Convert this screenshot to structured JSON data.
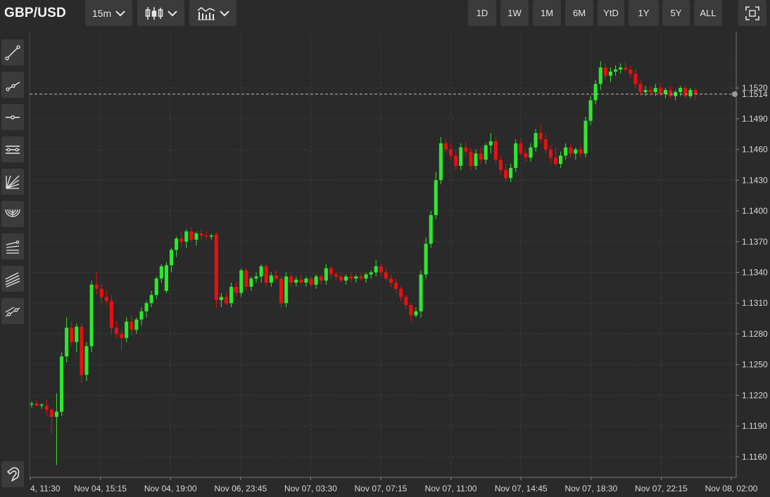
{
  "toolbar": {
    "symbol": "GBP/USD",
    "interval": "15m",
    "chart_type_icon": "candlestick-icon",
    "indicators_icon": "indicators-icon",
    "ranges": [
      "1D",
      "1W",
      "1M",
      "6M",
      "YtD",
      "1Y",
      "5Y",
      "ALL"
    ],
    "fullscreen_icon": "fullscreen-icon"
  },
  "tools": [
    "trend-line-icon",
    "ray-icon",
    "horizontal-line-icon",
    "parallel-channel-icon",
    "fib-fan-icon",
    "fib-arcs-icon",
    "fib-retracement-icon",
    "fib-channel-icon",
    "extended-line-icon",
    "magnet-icon"
  ],
  "colors": {
    "up": "#2ee82e",
    "down": "#e81010",
    "background": "#2a2a2a",
    "grid": "#3c3c3c"
  },
  "chart_data": {
    "type": "candlestick",
    "ylim": [
      1.114,
      1.1575
    ],
    "y_ticks": [
      "1.1520",
      "1.1490",
      "1.1460",
      "1.1430",
      "1.1400",
      "1.1370",
      "1.1340",
      "1.1310",
      "1.1280",
      "1.1250",
      "1.1220",
      "1.1190",
      "1.1160"
    ],
    "x_ticks": [
      "4, 11:30",
      "Nov 04, 15:15",
      "Nov 04, 19:00",
      "Nov 06, 23:45",
      "Nov 07, 03:30",
      "Nov 07, 07:15",
      "Nov 07, 11:00",
      "Nov 07, 14:45",
      "Nov 07, 18:30",
      "Nov 07, 22:15",
      "Nov 08, 02:00"
    ],
    "last_price": "1.1514",
    "grid": true,
    "candles": [
      [
        1.1211,
        1.1214,
        1.1208,
        1.1212
      ],
      [
        1.1212,
        1.1215,
        1.1209,
        1.121
      ],
      [
        1.121,
        1.1212,
        1.1207,
        1.1211
      ],
      [
        1.121,
        1.1216,
        1.12,
        1.1206
      ],
      [
        1.1206,
        1.1208,
        1.1182,
        1.1199
      ],
      [
        1.1199,
        1.1222,
        1.1152,
        1.1204
      ],
      [
        1.1204,
        1.1262,
        1.12,
        1.1258
      ],
      [
        1.1258,
        1.1296,
        1.1252,
        1.1286
      ],
      [
        1.1286,
        1.1292,
        1.1268,
        1.1272
      ],
      [
        1.1272,
        1.129,
        1.1262,
        1.1287
      ],
      [
        1.1287,
        1.129,
        1.1232,
        1.124
      ],
      [
        1.124,
        1.1272,
        1.1234,
        1.1268
      ],
      [
        1.1268,
        1.1332,
        1.1262,
        1.1328
      ],
      [
        1.1328,
        1.134,
        1.1318,
        1.1324
      ],
      [
        1.1324,
        1.133,
        1.131,
        1.1316
      ],
      [
        1.1316,
        1.1322,
        1.1308,
        1.1312
      ],
      [
        1.1312,
        1.1318,
        1.128,
        1.1286
      ],
      [
        1.1286,
        1.1292,
        1.1276,
        1.128
      ],
      [
        1.128,
        1.1284,
        1.1264,
        1.1276
      ],
      [
        1.1276,
        1.1296,
        1.1272,
        1.1292
      ],
      [
        1.1292,
        1.1298,
        1.1278,
        1.1284
      ],
      [
        1.1284,
        1.1296,
        1.128,
        1.1294
      ],
      [
        1.1294,
        1.1306,
        1.1288,
        1.1302
      ],
      [
        1.1302,
        1.1312,
        1.1296,
        1.131
      ],
      [
        1.131,
        1.1322,
        1.1306,
        1.1318
      ],
      [
        1.1318,
        1.1336,
        1.1314,
        1.1334
      ],
      [
        1.1334,
        1.1348,
        1.133,
        1.1346
      ],
      [
        1.1322,
        1.135,
        1.132,
        1.1347
      ],
      [
        1.1347,
        1.1364,
        1.134,
        1.1362
      ],
      [
        1.1362,
        1.1375,
        1.1355,
        1.1373
      ],
      [
        1.1373,
        1.138,
        1.1365,
        1.137
      ],
      [
        1.137,
        1.1382,
        1.1364,
        1.138
      ],
      [
        1.138,
        1.1384,
        1.137,
        1.1372
      ],
      [
        1.1372,
        1.138,
        1.1366,
        1.1378
      ],
      [
        1.1378,
        1.1382,
        1.1372,
        1.1376
      ],
      [
        1.1376,
        1.138,
        1.1372,
        1.1375
      ],
      [
        1.1375,
        1.1378,
        1.1372,
        1.1376
      ],
      [
        1.1377,
        1.1379,
        1.1305,
        1.1313
      ],
      [
        1.1313,
        1.132,
        1.1306,
        1.1316
      ],
      [
        1.1316,
        1.132,
        1.1308,
        1.131
      ],
      [
        1.131,
        1.133,
        1.1306,
        1.1326
      ],
      [
        1.1326,
        1.133,
        1.1316,
        1.132
      ],
      [
        1.132,
        1.1344,
        1.1316,
        1.1342
      ],
      [
        1.1342,
        1.1344,
        1.1322,
        1.1326
      ],
      [
        1.1326,
        1.1336,
        1.1322,
        1.1334
      ],
      [
        1.1334,
        1.134,
        1.133,
        1.1336
      ],
      [
        1.1336,
        1.1348,
        1.133,
        1.1346
      ],
      [
        1.1346,
        1.1348,
        1.1326,
        1.133
      ],
      [
        1.133,
        1.134,
        1.1326,
        1.1337
      ],
      [
        1.1337,
        1.1342,
        1.1332,
        1.1334
      ],
      [
        1.1334,
        1.1336,
        1.1306,
        1.131
      ],
      [
        1.131,
        1.134,
        1.1306,
        1.1336
      ],
      [
        1.1336,
        1.134,
        1.1326,
        1.133
      ],
      [
        1.133,
        1.1336,
        1.1326,
        1.1333
      ],
      [
        1.1333,
        1.1338,
        1.1328,
        1.133
      ],
      [
        1.133,
        1.1336,
        1.1326,
        1.1334
      ],
      [
        1.1334,
        1.1336,
        1.1326,
        1.1328
      ],
      [
        1.1328,
        1.1338,
        1.1324,
        1.1336
      ],
      [
        1.1336,
        1.1338,
        1.1328,
        1.1332
      ],
      [
        1.1332,
        1.1348,
        1.1328,
        1.1344
      ],
      [
        1.1344,
        1.1346,
        1.1334,
        1.1338
      ],
      [
        1.1338,
        1.134,
        1.1332,
        1.1336
      ],
      [
        1.1336,
        1.134,
        1.133,
        1.1332
      ],
      [
        1.1332,
        1.1338,
        1.1328,
        1.1336
      ],
      [
        1.1336,
        1.134,
        1.133,
        1.1334
      ],
      [
        1.1334,
        1.1338,
        1.133,
        1.1336
      ],
      [
        1.1336,
        1.134,
        1.1332,
        1.1334
      ],
      [
        1.1334,
        1.134,
        1.133,
        1.1338
      ],
      [
        1.1338,
        1.1342,
        1.1334,
        1.134
      ],
      [
        1.134,
        1.1352,
        1.1336,
        1.1346
      ],
      [
        1.1346,
        1.1348,
        1.1336,
        1.134
      ],
      [
        1.134,
        1.1344,
        1.1332,
        1.1334
      ],
      [
        1.1334,
        1.1338,
        1.1326,
        1.133
      ],
      [
        1.133,
        1.1334,
        1.132,
        1.1324
      ],
      [
        1.1324,
        1.1326,
        1.1312,
        1.1316
      ],
      [
        1.1316,
        1.1318,
        1.1304,
        1.1308
      ],
      [
        1.1308,
        1.131,
        1.1292,
        1.1298
      ],
      [
        1.1298,
        1.1306,
        1.1296,
        1.1302
      ],
      [
        1.1302,
        1.1342,
        1.1296,
        1.1338
      ],
      [
        1.1338,
        1.1374,
        1.1334,
        1.1368
      ],
      [
        1.1368,
        1.14,
        1.1364,
        1.1396
      ],
      [
        1.1396,
        1.1438,
        1.1392,
        1.143
      ],
      [
        1.143,
        1.1472,
        1.1426,
        1.1466
      ],
      [
        1.1466,
        1.147,
        1.1456,
        1.146
      ],
      [
        1.146,
        1.1466,
        1.145,
        1.1454
      ],
      [
        1.1454,
        1.146,
        1.144,
        1.1444
      ],
      [
        1.1444,
        1.1466,
        1.144,
        1.1462
      ],
      [
        1.1462,
        1.1468,
        1.1452,
        1.1458
      ],
      [
        1.1458,
        1.1462,
        1.144,
        1.1444
      ],
      [
        1.1444,
        1.146,
        1.144,
        1.1456
      ],
      [
        1.1456,
        1.1462,
        1.1446,
        1.145
      ],
      [
        1.145,
        1.1466,
        1.1446,
        1.1464
      ],
      [
        1.1464,
        1.1476,
        1.1456,
        1.1468
      ],
      [
        1.1468,
        1.1472,
        1.1446,
        1.145
      ],
      [
        1.145,
        1.1454,
        1.1436,
        1.144
      ],
      [
        1.144,
        1.1446,
        1.1428,
        1.1432
      ],
      [
        1.1432,
        1.1446,
        1.1428,
        1.1442
      ],
      [
        1.1442,
        1.147,
        1.1438,
        1.1466
      ],
      [
        1.1466,
        1.147,
        1.1454,
        1.1456
      ],
      [
        1.1456,
        1.146,
        1.1448,
        1.1452
      ],
      [
        1.1452,
        1.1466,
        1.1448,
        1.1462
      ],
      [
        1.1462,
        1.148,
        1.1458,
        1.1476
      ],
      [
        1.1476,
        1.1484,
        1.1466,
        1.147
      ],
      [
        1.147,
        1.1476,
        1.1456,
        1.146
      ],
      [
        1.146,
        1.1464,
        1.1446,
        1.1452
      ],
      [
        1.1452,
        1.1462,
        1.1444,
        1.1446
      ],
      [
        1.1446,
        1.1458,
        1.1442,
        1.1454
      ],
      [
        1.1454,
        1.1466,
        1.145,
        1.1462
      ],
      [
        1.1462,
        1.1466,
        1.1452,
        1.1456
      ],
      [
        1.1456,
        1.1462,
        1.145,
        1.146
      ],
      [
        1.146,
        1.1464,
        1.1452,
        1.1456
      ],
      [
        1.1456,
        1.1492,
        1.1452,
        1.1488
      ],
      [
        1.1488,
        1.1512,
        1.1484,
        1.1508
      ],
      [
        1.1508,
        1.1528,
        1.1504,
        1.1524
      ],
      [
        1.1524,
        1.1546,
        1.1518,
        1.154
      ],
      [
        1.154,
        1.1544,
        1.1528,
        1.1532
      ],
      [
        1.1532,
        1.154,
        1.1526,
        1.1536
      ],
      [
        1.1536,
        1.1542,
        1.1532,
        1.1538
      ],
      [
        1.1538,
        1.1544,
        1.1534,
        1.154
      ],
      [
        1.154,
        1.1546,
        1.1536,
        1.1538
      ],
      [
        1.1538,
        1.1542,
        1.153,
        1.1534
      ],
      [
        1.1534,
        1.1538,
        1.152,
        1.1524
      ],
      [
        1.1524,
        1.1528,
        1.1512,
        1.1516
      ],
      [
        1.1516,
        1.1522,
        1.1512,
        1.1518
      ],
      [
        1.1518,
        1.1522,
        1.1512,
        1.1516
      ],
      [
        1.1516,
        1.1524,
        1.1512,
        1.152
      ],
      [
        1.152,
        1.1524,
        1.1512,
        1.1514
      ],
      [
        1.1514,
        1.152,
        1.151,
        1.1518
      ],
      [
        1.1518,
        1.1522,
        1.151,
        1.1512
      ],
      [
        1.1512,
        1.1518,
        1.1508,
        1.1516
      ],
      [
        1.1516,
        1.1522,
        1.1512,
        1.152
      ],
      [
        1.152,
        1.1522,
        1.151,
        1.1512
      ],
      [
        1.1512,
        1.152,
        1.151,
        1.1518
      ],
      [
        1.1518,
        1.152,
        1.1508,
        1.1514
      ]
    ]
  }
}
